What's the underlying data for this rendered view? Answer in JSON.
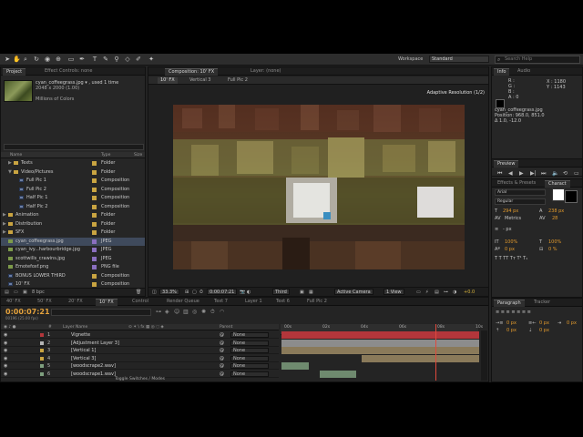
{
  "toolbar": {
    "workspace_label": "Workspace",
    "workspace_value": "Standard",
    "search_placeholder": "Search Help"
  },
  "project": {
    "tabs": [
      "Project",
      "Effect Controls: none"
    ],
    "file_name": "cyan_coffeegrass.jpg ▾ , used 1 time",
    "file_dims": "2048 x 2000 (1.00)",
    "file_colors": "Millions of Colors",
    "col_name": "Name",
    "col_type": "Type",
    "col_size": "Size",
    "rows": [
      {
        "name": "Texts",
        "type": "Folder",
        "kind": "folder",
        "indent": 1,
        "tri": "▶",
        "color": "#c9a441"
      },
      {
        "name": "Video/Pictures",
        "type": "Folder",
        "kind": "folder",
        "indent": 1,
        "tri": "▼",
        "color": "#c9a441"
      },
      {
        "name": "Full Pic 1",
        "type": "Composition",
        "kind": "comp",
        "indent": 2,
        "tri": "",
        "color": "#c9a441"
      },
      {
        "name": "Full Pic 2",
        "type": "Composition",
        "kind": "comp",
        "indent": 2,
        "tri": "",
        "color": "#c9a441"
      },
      {
        "name": "Half Pic 1",
        "type": "Composition",
        "kind": "comp",
        "indent": 2,
        "tri": "",
        "color": "#c9a441"
      },
      {
        "name": "Half Pic 2",
        "type": "Composition",
        "kind": "comp",
        "indent": 2,
        "tri": "",
        "color": "#c9a441"
      },
      {
        "name": "Animation",
        "type": "Folder",
        "kind": "folder",
        "indent": 0,
        "tri": "▶",
        "color": "#c9a441"
      },
      {
        "name": "Distribution",
        "type": "Folder",
        "kind": "folder",
        "indent": 0,
        "tri": "▶",
        "color": "#c9a441"
      },
      {
        "name": "SFX",
        "type": "Folder",
        "kind": "folder",
        "indent": 0,
        "tri": "▶",
        "color": "#c9a441"
      },
      {
        "name": "cyan_coffeegrass.jpg",
        "type": "JPEG",
        "kind": "image",
        "indent": 0,
        "tri": "",
        "color": "#8a6fbf",
        "selected": true
      },
      {
        "name": "cyan_ivy...harbourbridge.jpg",
        "type": "JPEG",
        "kind": "image",
        "indent": 0,
        "tri": "",
        "color": "#8a6fbf"
      },
      {
        "name": "scottwills_crawins.jpg",
        "type": "JPEG",
        "kind": "image",
        "indent": 0,
        "tri": "",
        "color": "#8a6fbf"
      },
      {
        "name": "Emotefoxf.png",
        "type": "PNG file",
        "kind": "image",
        "indent": 0,
        "tri": "",
        "color": "#8a6fbf"
      },
      {
        "name": "BONUS LOWER THIRD",
        "type": "Composition",
        "kind": "comp",
        "indent": 0,
        "tri": "",
        "color": "#c9a441"
      },
      {
        "name": "10' FX",
        "type": "Composition",
        "kind": "comp",
        "indent": 0,
        "tri": "",
        "color": "#c9a441"
      },
      {
        "name": "20' FX",
        "type": "Composition",
        "kind": "comp",
        "indent": 0,
        "tri": "",
        "color": "#c9a441"
      }
    ],
    "bpc": "8 bpc"
  },
  "composition": {
    "tabs": [
      "Composition: 10' FX",
      "Layer: (none)"
    ],
    "subtabs": [
      "10' FX",
      "Vertical 3",
      "Full Pic 2"
    ],
    "adaptive": "Adaptive Resolution (1/2)",
    "zoom": "33.3%",
    "timecode": "0:00:07:21",
    "resolution": "Third",
    "camera": "Active Camera",
    "views": "1 View",
    "exposure": "+0.0"
  },
  "info": {
    "tabs": [
      "Info",
      "Audio"
    ],
    "r": "R :",
    "g": "G :",
    "b": "B :",
    "a": "A : 0",
    "x": "X : 1180",
    "y": "Y : 1143",
    "source": "cyan_coffeegrass.jpg",
    "position": "Position: 968.0, 851.0",
    "delta": "Δ 1.0, -12.0"
  },
  "preview": {
    "tab": "Preview"
  },
  "effects": {
    "tabs": [
      "Effects & Presets",
      "Charact"
    ],
    "font": "Arial",
    "style": "Regular",
    "size": "294 px",
    "leading": "238 px",
    "kerning": "Metrics",
    "tracking": "28",
    "unit1": "- px",
    "unit2": "- px",
    "scale_v": "100%",
    "scale_h": "100%",
    "baseline": "0 px",
    "tsume": "0 %"
  },
  "paragraph": {
    "tabs": [
      "Paragraph",
      "Tracker"
    ],
    "indent1": "0 px",
    "indent2": "0 px",
    "indent3": "0 px",
    "space1": "0 px",
    "space2": "0 px"
  },
  "timeline": {
    "tabs": [
      "40' FX",
      "50' FX",
      "20' FX",
      "10' FX",
      "Control",
      "Render Queue",
      "Text 7",
      "Layer 1",
      "Text 6",
      "Full Pic 2"
    ],
    "active_tab": 3,
    "timecode": "0:00:07:21",
    "fps": "00196 (25.00 fps)",
    "col_layer": "Layer Name",
    "col_parent": "Parent",
    "layers": [
      {
        "num": "1",
        "name": "Vignette",
        "parent": "None",
        "label": "#b3363b"
      },
      {
        "num": "2",
        "name": "[Adjustment Layer 3]",
        "parent": "None",
        "label": "#b5b5b5"
      },
      {
        "num": "3",
        "name": "[Vertical 1]",
        "parent": "None",
        "label": "#c9a441"
      },
      {
        "num": "4",
        "name": "[Vertical 3]",
        "parent": "None",
        "label": "#c9a441"
      },
      {
        "num": "5",
        "name": "[woodscrape2.wav]",
        "parent": "None",
        "label": "#7fa07f"
      },
      {
        "num": "6",
        "name": "[woodscrape1.wav]",
        "parent": "None",
        "label": "#7fa07f"
      }
    ],
    "ruler": [
      "00s",
      "02s",
      "04s",
      "06s",
      "08s",
      "10s"
    ],
    "footer": "Toggle Switches / Modes"
  }
}
